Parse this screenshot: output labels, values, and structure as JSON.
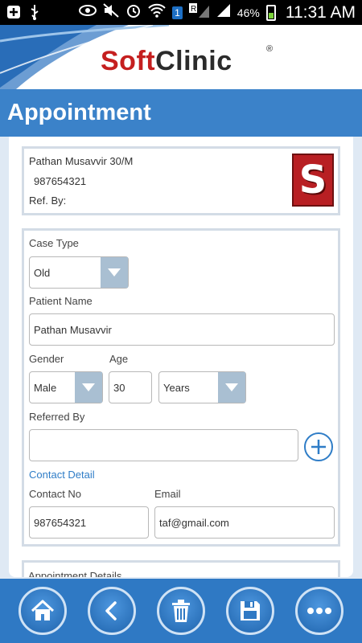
{
  "status_bar": {
    "battery": "46%",
    "time": "11:31 AM",
    "sim_badge": "1",
    "roaming_badge": "R"
  },
  "brand": {
    "name_part1": "Soft",
    "name_part2": "Clinic",
    "registered": "®"
  },
  "page": {
    "title": "Appointment"
  },
  "patient": {
    "name_line": "Pathan Musavvir  30/M",
    "phone": "987654321",
    "ref_by_label": "Ref. By:",
    "logo_letter": "S"
  },
  "form": {
    "case_type_label": "Case Type",
    "case_type_value": "Old",
    "patient_name_label": "Patient Name",
    "patient_name_value": "Pathan Musavvir",
    "gender_label": "Gender",
    "gender_value": "Male",
    "age_label": "Age",
    "age_value": "30",
    "age_unit_value": "Years",
    "referred_by_label": "Referred By",
    "referred_by_value": "",
    "contact_detail_link": "Contact Detail",
    "contact_no_label": "Contact No",
    "contact_no_value": "987654321",
    "email_label": "Email",
    "email_value": "taf@gmail.com"
  },
  "next_section": {
    "label": "Appointment Details"
  },
  "toolbar": {
    "buttons": [
      "home-icon",
      "back-icon",
      "trash-icon",
      "save-icon",
      "more-icon"
    ]
  },
  "colors": {
    "header_blue": "#3b82c9",
    "toolbar_blue": "#2f79c4",
    "brand_red": "#c51f1f",
    "link_blue": "#2f7dc7"
  }
}
